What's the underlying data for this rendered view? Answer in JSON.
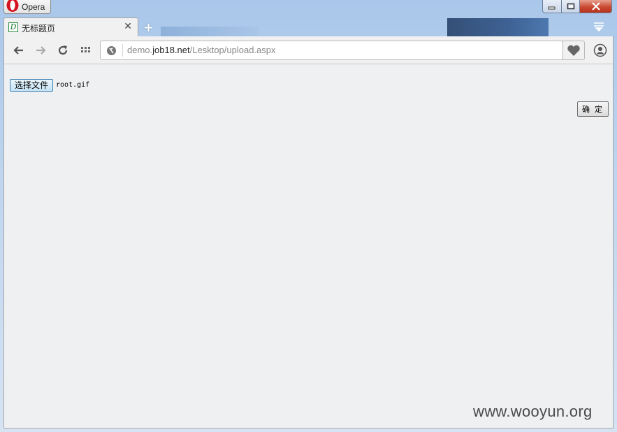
{
  "app": {
    "menu_label": "Opera"
  },
  "tabs": [
    {
      "title": "无标题页",
      "favicon": "D"
    }
  ],
  "toolbar": {
    "url_prefix": "demo.",
    "url_domain": "job18.net",
    "url_path": "/Lesktop/upload.aspx"
  },
  "page": {
    "file_button_label": "选择文件",
    "file_name": "root.gif",
    "ok_button_label": "确 定"
  },
  "watermark": "www.wooyun.org"
}
